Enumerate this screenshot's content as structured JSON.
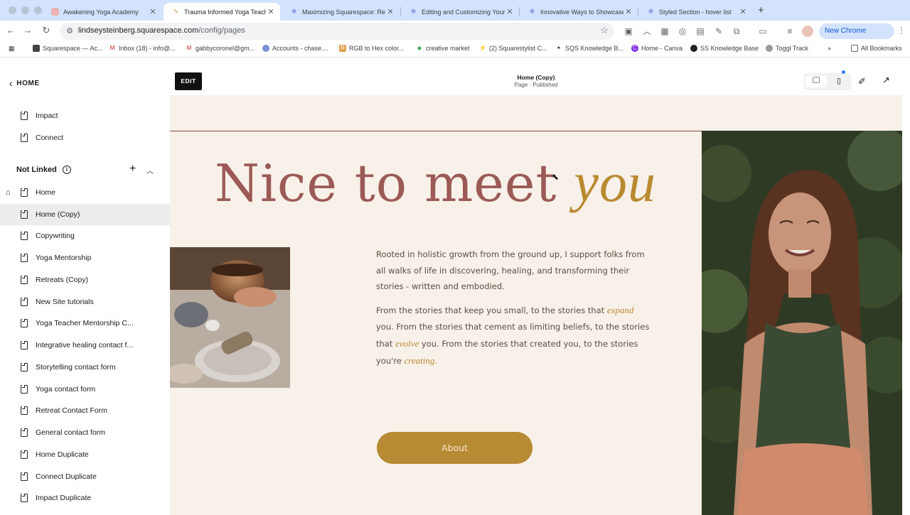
{
  "browser": {
    "tabs": [
      {
        "title": "Awakening Yoga Academy",
        "active": false
      },
      {
        "title": "Trauma Informed Yoga Teach",
        "active": true
      },
      {
        "title": "Maximizing Squarespace: Re",
        "active": false
      },
      {
        "title": "Editing and Customizing Your",
        "active": false
      },
      {
        "title": "Innovative Ways to Showcase",
        "active": false
      },
      {
        "title": "Styled Section - hover list",
        "active": false
      }
    ],
    "url_host": "lindseysteinberg.squarespace.com",
    "url_path": "/config/pages",
    "new_chrome_label": "New Chrome available",
    "bookmarks": [
      "Squarespace — Ac...",
      "Inbox (18) - info@...",
      "gabbycoronel@gm...",
      "Accounts - chase....",
      "RGB to Hex color...",
      "creative market",
      "(2) Squarestylist C...",
      "SQS Knowledge B...",
      "Home - Canva",
      "SS Knowledge Base",
      "Toggl Track"
    ],
    "all_bookmarks_label": "All Bookmarks"
  },
  "sidebar": {
    "back_label": "HOME",
    "linked_pages": [
      "Impact",
      "Connect"
    ],
    "section_title": "Not Linked",
    "not_linked_pages": [
      "Home",
      "Home (Copy)",
      "Copywriting",
      "Yoga Mentorship",
      "Retreats (Copy)",
      "New Site tutorials",
      "Yoga Teacher Mentorship C...",
      "Integrative healing contact f...",
      "Storytelling contact form",
      "Yoga contact form",
      "Retreat Contact Form",
      "General contact form",
      "Home Duplicate",
      "Connect Duplicate",
      "Impact Duplicate"
    ],
    "selected_page": "Home (Copy)"
  },
  "editor": {
    "edit_label": "EDIT",
    "page_title": "Home (Copy)",
    "page_status": "Page · Published"
  },
  "site": {
    "headline_main": "Nice to meet ",
    "headline_accent": "you",
    "para1": "Rooted in holistic growth from the ground up, I support folks from all walks of life in discovering, healing, and transforming their stories - written and embodied.",
    "para2_a": "From the stories that keep you small, to the stories that ",
    "para2_expand": "expand",
    "para2_b": " you. From the stories that cement as limiting beliefs, to the stories that ",
    "para2_evolve": "evolve",
    "para2_c": " you. From the stories that created you, to the stories you're ",
    "para2_creating": "creating.",
    "button_label": "About",
    "colors": {
      "background": "#f8f1e9",
      "headline": "#9c5a56",
      "accent": "#b98a30",
      "button": "#b78a34",
      "body_text": "#5d4b42"
    }
  }
}
